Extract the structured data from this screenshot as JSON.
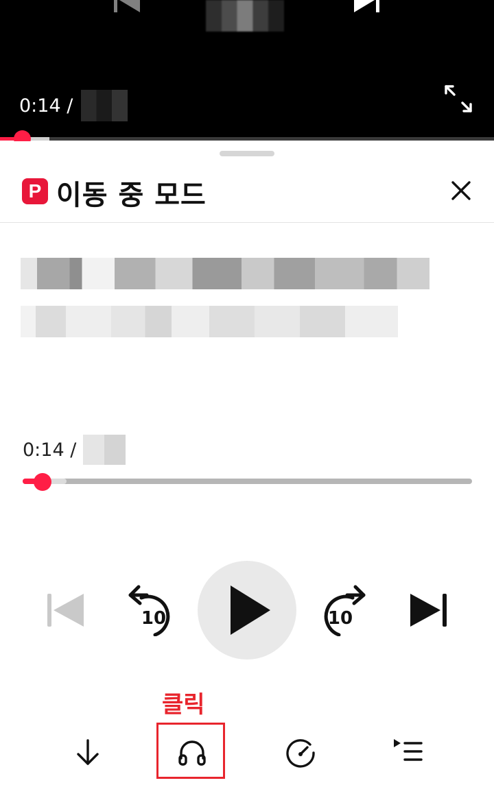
{
  "video": {
    "current_time": "0:14 /",
    "progress_fraction": 0.046
  },
  "sheet": {
    "badge": "P",
    "title": "이동 중 모드",
    "current_time": "0:14 /",
    "progress_fraction": 0.046
  },
  "controls": {
    "prev": "skip-previous-icon",
    "rewind_label": "10",
    "play": "play-icon",
    "forward_label": "10",
    "next": "skip-next-icon"
  },
  "annotation": {
    "label": "클릭",
    "color": "#e8252d"
  },
  "bottom_bar": {
    "items": [
      "download-icon",
      "headphones-icon",
      "speed-icon",
      "playlist-icon"
    ]
  },
  "colors": {
    "accent": "#ff1e46",
    "badge": "#e8173a"
  }
}
